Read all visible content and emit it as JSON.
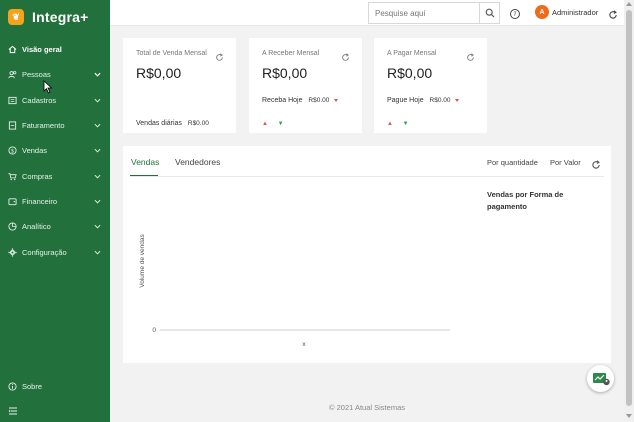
{
  "app": {
    "name": "Integra+",
    "logo_glyph": "❦"
  },
  "sidebar": {
    "items": [
      {
        "label": "Visão geral",
        "icon": "home-icon"
      },
      {
        "label": "Pessoas",
        "icon": "people-icon"
      },
      {
        "label": "Cadastros",
        "icon": "register-icon"
      },
      {
        "label": "Faturamento",
        "icon": "invoice-icon"
      },
      {
        "label": "Vendas",
        "icon": "dollar-icon"
      },
      {
        "label": "Compras",
        "icon": "cart-icon"
      },
      {
        "label": "Financeiro",
        "icon": "wallet-icon"
      },
      {
        "label": "Analítico",
        "icon": "analytics-icon"
      },
      {
        "label": "Configuração",
        "icon": "gear-icon"
      }
    ],
    "sobre": "Sobre"
  },
  "topbar": {
    "search_placeholder": "Pesquise aqui",
    "avatar_initial": "A",
    "user_name": "Administrador"
  },
  "cards": [
    {
      "title": "Total de Venda Mensal",
      "value": "R$0,00",
      "footer_label": "Vendas diárias",
      "footer_value": "R$0.00"
    },
    {
      "title": "A Receber Mensal",
      "value": "R$0,00",
      "sub_label": "Receba Hoje",
      "sub_value": "R$0.00"
    },
    {
      "title": "A Pagar Mensal",
      "value": "R$0,00",
      "sub_label": "Pague Hoje",
      "sub_value": "R$0.00"
    }
  ],
  "panel": {
    "tabs": [
      "Vendas",
      "Vendedores"
    ],
    "sort_options": [
      "Por quantidade",
      "Por Valor"
    ],
    "pie_title": "Vendas por Forma de pagamento"
  },
  "chart_data": {
    "type": "bar",
    "categories": [],
    "values": [],
    "xlabel": "x",
    "ylabel": "Volume de vendas",
    "yticks": [
      "0"
    ]
  },
  "footer": "© 2021 Atual Sistemas",
  "colors": {
    "sidebar": "#22713c",
    "accent": "#22713c",
    "avatar": "#f06a1a",
    "logo": "#f5a21c"
  }
}
